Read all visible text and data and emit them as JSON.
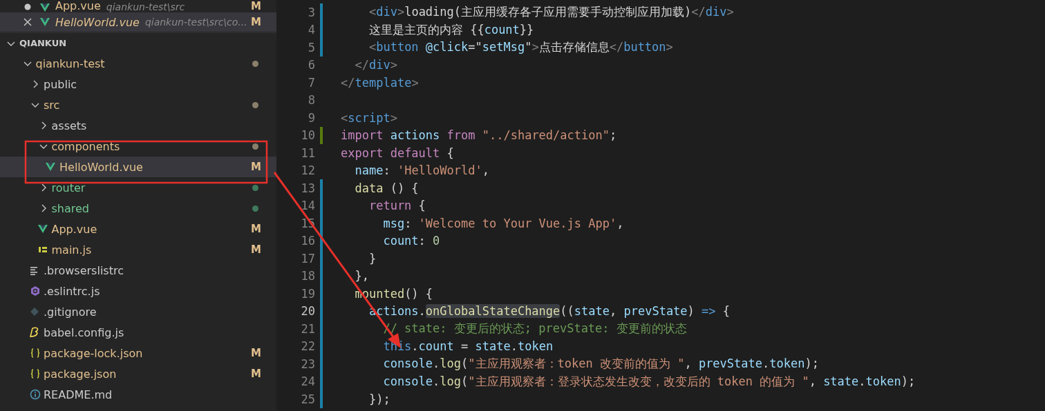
{
  "open_editors": [
    {
      "name": "App.vue",
      "description": "qiankun-test\\src",
      "badge": "M",
      "dirty": true,
      "preview": false,
      "selected": false
    },
    {
      "name": "HelloWorld.vue",
      "description": "qiankun-test\\src\\co...",
      "badge": "M",
      "dirty": false,
      "preview": true,
      "selected": true
    }
  ],
  "explorer": {
    "title": "QIANKUN",
    "expanded": true,
    "items": [
      {
        "name": "qiankun-test",
        "kind": "folder",
        "expanded": true,
        "selected": false,
        "modified": true,
        "untracked": false,
        "children": [
          {
            "name": "public",
            "kind": "folder",
            "expanded": false,
            "selected": false,
            "modified": false,
            "untracked": false
          },
          {
            "name": "src",
            "kind": "folder",
            "expanded": true,
            "selected": false,
            "modified": true,
            "untracked": false,
            "children": [
              {
                "name": "assets",
                "kind": "folder",
                "expanded": false,
                "selected": false,
                "modified": false,
                "untracked": false
              },
              {
                "name": "components",
                "kind": "folder",
                "expanded": true,
                "selected": false,
                "modified": true,
                "untracked": false,
                "children": [
                  {
                    "name": "HelloWorld.vue",
                    "kind": "vue",
                    "selected": true,
                    "modified": true,
                    "untracked": false,
                    "badge": "M"
                  }
                ]
              },
              {
                "name": "router",
                "kind": "folder",
                "expanded": false,
                "selected": false,
                "modified": false,
                "untracked": true
              },
              {
                "name": "shared",
                "kind": "folder",
                "expanded": false,
                "selected": false,
                "modified": false,
                "untracked": true
              },
              {
                "name": "App.vue",
                "kind": "vue",
                "selected": false,
                "modified": true,
                "untracked": false,
                "badge": "M"
              },
              {
                "name": "main.js",
                "kind": "js",
                "selected": false,
                "modified": true,
                "untracked": false,
                "badge": "M"
              }
            ]
          },
          {
            "name": ".browserslistrc",
            "kind": "text",
            "selected": false,
            "modified": false,
            "untracked": false
          },
          {
            "name": ".eslintrc.js",
            "kind": "eslint",
            "selected": false,
            "modified": false,
            "untracked": false
          },
          {
            "name": ".gitignore",
            "kind": "gitignore",
            "selected": false,
            "modified": false,
            "untracked": false
          },
          {
            "name": "babel.config.js",
            "kind": "babel",
            "selected": false,
            "modified": false,
            "untracked": false
          },
          {
            "name": "package-lock.json",
            "kind": "json",
            "selected": false,
            "modified": true,
            "untracked": false,
            "badge": "M"
          },
          {
            "name": "package.json",
            "kind": "json",
            "selected": false,
            "modified": true,
            "untracked": false,
            "badge": "M"
          },
          {
            "name": "README.md",
            "kind": "info",
            "selected": false,
            "modified": false,
            "untracked": false
          }
        ]
      }
    ]
  },
  "editor": {
    "lines": [
      {
        "number": "3",
        "modified": true,
        "added": false,
        "current": false,
        "tokens": [
          {
            "t": "    <",
            "kind": "punct"
          },
          {
            "t": "div",
            "kind": "tag"
          },
          {
            "t": ">",
            "kind": "punct"
          },
          {
            "t": "loading(主应用缓存各子应用需要手动控制应用加载)",
            "kind": "text"
          },
          {
            "t": "</",
            "kind": "punct"
          },
          {
            "t": "div",
            "kind": "tag"
          },
          {
            "t": ">",
            "kind": "punct"
          }
        ]
      },
      {
        "number": "4",
        "modified": true,
        "added": false,
        "current": false,
        "tokens": [
          {
            "t": "    这里是主页的内容 {{",
            "kind": "text"
          },
          {
            "t": "count",
            "kind": "var"
          },
          {
            "t": "}}",
            "kind": "text"
          }
        ]
      },
      {
        "number": "5",
        "modified": true,
        "added": false,
        "current": false,
        "tokens": [
          {
            "t": "    <",
            "kind": "punct"
          },
          {
            "t": "button ",
            "kind": "tag"
          },
          {
            "t": "@click",
            "kind": "var"
          },
          {
            "t": "=\"",
            "kind": "text"
          },
          {
            "t": "setMsg",
            "kind": "var"
          },
          {
            "t": "\"",
            "kind": "text"
          },
          {
            "t": ">",
            "kind": "punct"
          },
          {
            "t": "点击存储信息",
            "kind": "text"
          },
          {
            "t": "</",
            "kind": "punct"
          },
          {
            "t": "button",
            "kind": "tag"
          },
          {
            "t": ">",
            "kind": "punct"
          }
        ]
      },
      {
        "number": "6",
        "modified": false,
        "added": false,
        "current": false,
        "tokens": [
          {
            "t": "  </",
            "kind": "punct"
          },
          {
            "t": "div",
            "kind": "tag"
          },
          {
            "t": ">",
            "kind": "punct"
          }
        ]
      },
      {
        "number": "7",
        "modified": false,
        "added": false,
        "current": false,
        "tokens": [
          {
            "t": "</",
            "kind": "punct"
          },
          {
            "t": "template",
            "kind": "tag"
          },
          {
            "t": ">",
            "kind": "punct"
          }
        ]
      },
      {
        "number": "8",
        "modified": false,
        "added": false,
        "current": false
      },
      {
        "number": "9",
        "modified": false,
        "added": false,
        "current": false,
        "tokens": [
          {
            "t": "<",
            "kind": "punct"
          },
          {
            "t": "script",
            "kind": "tag"
          },
          {
            "t": ">",
            "kind": "punct"
          }
        ]
      },
      {
        "number": "10",
        "modified": false,
        "added": true,
        "current": false,
        "tokens": [
          {
            "t": "import ",
            "kind": "keyword"
          },
          {
            "t": "actions ",
            "kind": "var"
          },
          {
            "t": "from ",
            "kind": "keyword"
          },
          {
            "t": "\"../shared/action\"",
            "kind": "string"
          },
          {
            "t": ";",
            "kind": "text"
          }
        ]
      },
      {
        "number": "11",
        "modified": false,
        "added": false,
        "current": false,
        "tokens": [
          {
            "t": "export ",
            "kind": "keyword"
          },
          {
            "t": "default",
            "kind": "keyword"
          },
          {
            "t": " {",
            "kind": "text"
          }
        ]
      },
      {
        "number": "12",
        "modified": false,
        "added": false,
        "current": false,
        "tokens": [
          {
            "t": "  name",
            "kind": "var"
          },
          {
            "t": ": ",
            "kind": "text"
          },
          {
            "t": "'HelloWorld'",
            "kind": "string"
          },
          {
            "t": ",",
            "kind": "text"
          }
        ]
      },
      {
        "number": "13",
        "modified": true,
        "added": false,
        "current": false,
        "tokens": [
          {
            "t": "  data",
            "kind": "function"
          },
          {
            "t": " () {",
            "kind": "text"
          }
        ]
      },
      {
        "number": "14",
        "modified": true,
        "added": false,
        "current": false,
        "tokens": [
          {
            "t": "    return",
            "kind": "keyword"
          },
          {
            "t": " {",
            "kind": "text"
          }
        ]
      },
      {
        "number": "15",
        "modified": true,
        "added": false,
        "current": false,
        "tokens": [
          {
            "t": "      msg",
            "kind": "var"
          },
          {
            "t": ": ",
            "kind": "text"
          },
          {
            "t": "'Welcome to Your Vue.js App'",
            "kind": "string"
          },
          {
            "t": ",",
            "kind": "text"
          }
        ]
      },
      {
        "number": "16",
        "modified": true,
        "added": false,
        "current": false,
        "tokens": [
          {
            "t": "      count",
            "kind": "var"
          },
          {
            "t": ": ",
            "kind": "text"
          },
          {
            "t": "0",
            "kind": "number"
          }
        ]
      },
      {
        "number": "17",
        "modified": true,
        "added": false,
        "current": false,
        "tokens": [
          {
            "t": "    }",
            "kind": "text"
          }
        ]
      },
      {
        "number": "18",
        "modified": true,
        "added": false,
        "current": false,
        "tokens": [
          {
            "t": "  },",
            "kind": "text"
          }
        ]
      },
      {
        "number": "19",
        "modified": true,
        "added": false,
        "current": false,
        "tokens": [
          {
            "t": "  mounted",
            "kind": "function"
          },
          {
            "t": "() {",
            "kind": "text"
          }
        ]
      },
      {
        "number": "20",
        "modified": true,
        "added": false,
        "current": true,
        "tokens": [
          {
            "t": "    actions",
            "kind": "var"
          },
          {
            "t": ".",
            "kind": "text"
          },
          {
            "t": "onGlobalStateChange",
            "kind": "function",
            "highlight": true
          },
          {
            "t": "((",
            "kind": "text"
          },
          {
            "t": "state",
            "kind": "var"
          },
          {
            "t": ", ",
            "kind": "text"
          },
          {
            "t": "prevState",
            "kind": "var"
          },
          {
            "t": ") ",
            "kind": "text"
          },
          {
            "t": "=>",
            "kind": "tag"
          },
          {
            "t": " {",
            "kind": "text"
          }
        ]
      },
      {
        "number": "21",
        "modified": true,
        "added": false,
        "current": false,
        "tokens": [
          {
            "t": "      // state: 变更后的状态; prevState: 变更前的状态",
            "kind": "comment"
          }
        ]
      },
      {
        "number": "22",
        "modified": true,
        "added": false,
        "current": false,
        "tokens": [
          {
            "t": "      this",
            "kind": "tag"
          },
          {
            "t": ".",
            "kind": "text"
          },
          {
            "t": "count",
            "kind": "var"
          },
          {
            "t": " = ",
            "kind": "text"
          },
          {
            "t": "state",
            "kind": "var"
          },
          {
            "t": ".",
            "kind": "text"
          },
          {
            "t": "token",
            "kind": "var"
          }
        ]
      },
      {
        "number": "23",
        "modified": true,
        "added": false,
        "current": false,
        "tokens": [
          {
            "t": "      console",
            "kind": "var"
          },
          {
            "t": ".",
            "kind": "text"
          },
          {
            "t": "log",
            "kind": "function"
          },
          {
            "t": "(",
            "kind": "text"
          },
          {
            "t": "\"主应用观察者：token 改变前的值为 \"",
            "kind": "string"
          },
          {
            "t": ", ",
            "kind": "text"
          },
          {
            "t": "prevState",
            "kind": "var"
          },
          {
            "t": ".",
            "kind": "text"
          },
          {
            "t": "token",
            "kind": "var"
          },
          {
            "t": ");",
            "kind": "text"
          }
        ]
      },
      {
        "number": "24",
        "modified": true,
        "added": false,
        "current": false,
        "tokens": [
          {
            "t": "      console",
            "kind": "var"
          },
          {
            "t": ".",
            "kind": "text"
          },
          {
            "t": "log",
            "kind": "function"
          },
          {
            "t": "(",
            "kind": "text"
          },
          {
            "t": "\"主应用观察者：登录状态发生改变，改变后的 token 的值为 \"",
            "kind": "string"
          },
          {
            "t": ", ",
            "kind": "text"
          },
          {
            "t": "state",
            "kind": "var"
          },
          {
            "t": ".",
            "kind": "text"
          },
          {
            "t": "token",
            "kind": "var"
          },
          {
            "t": ");",
            "kind": "text"
          }
        ]
      },
      {
        "number": "25",
        "modified": true,
        "added": false,
        "current": false,
        "tokens": [
          {
            "t": "    });",
            "kind": "text"
          }
        ]
      }
    ]
  },
  "markup": {
    "frame": true,
    "arrow": true
  }
}
